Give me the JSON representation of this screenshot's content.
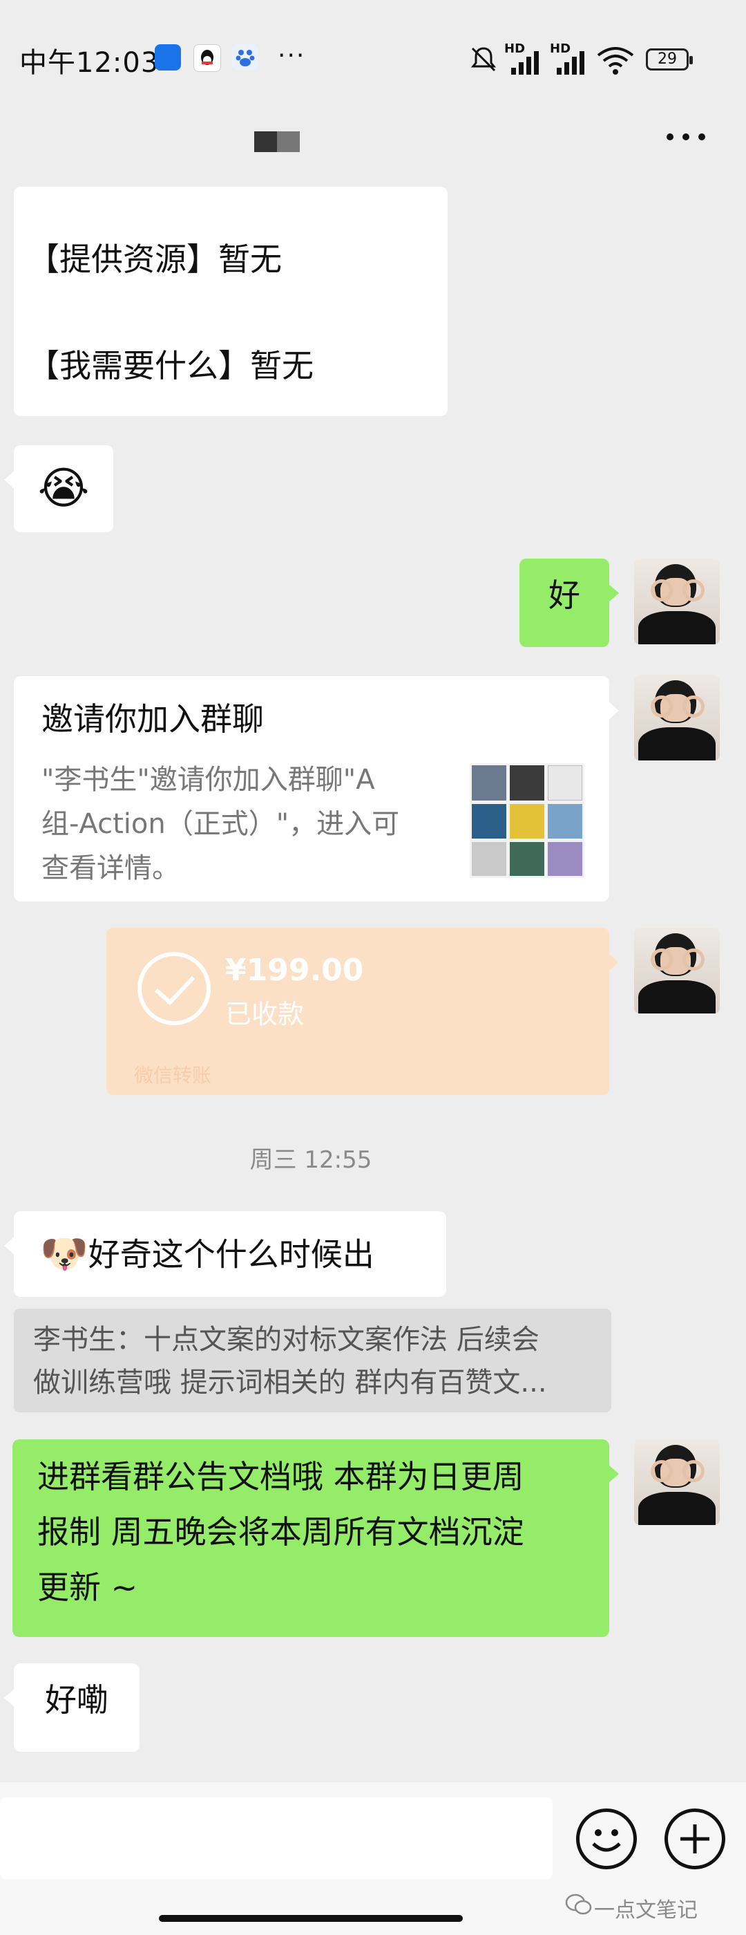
{
  "status_bar": {
    "time": "中午12:03",
    "overflow": "···",
    "battery": "29",
    "signal_labels": [
      "HD",
      "HD"
    ]
  },
  "header": {
    "more_icon": "more-horizontal-icon"
  },
  "messages": {
    "m1_line1": "【提供资源】暂无",
    "m1_line2": "【我需要什么】暂无",
    "m2_emoji": "😭",
    "m3": "好",
    "invite": {
      "title": "邀请你加入群聊",
      "line1": "\"李书生\"邀请你加入群聊\"A",
      "line2": "组-Action（正式）\"，进入可",
      "line3": "查看详情。"
    },
    "transfer": {
      "amount": "¥199.00",
      "status": "已收款",
      "footer": "微信转账"
    },
    "timestamp": "周三 12:55",
    "m4_emoji": "🐶",
    "m4": "好奇这个什么时候出",
    "quote_line1": "李书生：十点文案的对标文案作法 后续会",
    "quote_line2": "做训练营哦 提示词相关的 群内有百赞文...",
    "m5_line1": "进群看群公告文档哦 本群为日更周",
    "m5_line2": "报制 周五晚会将本周所有文档沉淀",
    "m5_line3": "更新 ~",
    "m6": "好嘞"
  },
  "input": {
    "emoji_icon": "smiley-icon",
    "plus_icon": "plus-circle-icon"
  },
  "watermark": "一点文笔记",
  "colors": {
    "background": "#ededed",
    "bubble_green": "#95ec69",
    "bubble_white": "#ffffff",
    "transfer": "#fbe0c6"
  }
}
